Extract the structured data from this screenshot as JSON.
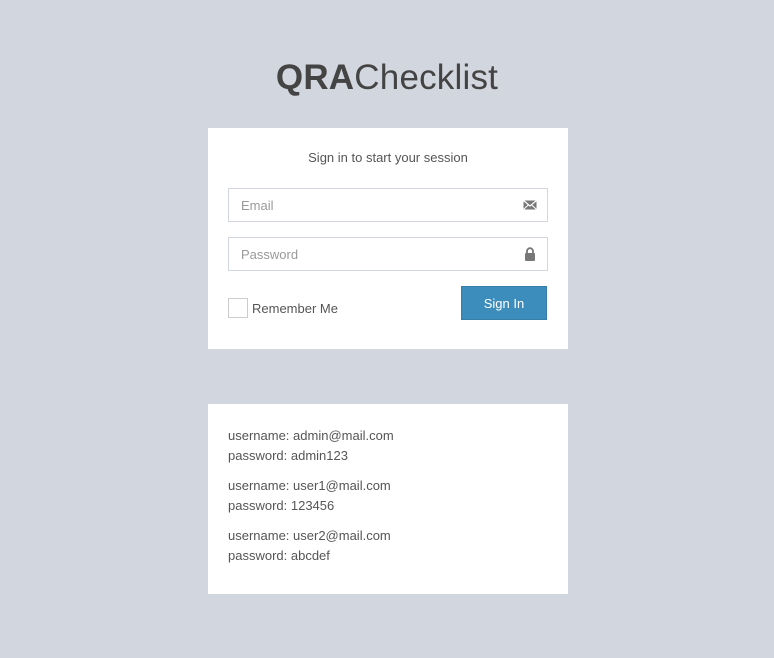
{
  "logo": {
    "bold": "QRA",
    "light": "Checklist"
  },
  "login": {
    "message": "Sign in to start your session",
    "email_placeholder": "Email",
    "password_placeholder": "Password",
    "remember_label": "Remember Me",
    "signin_label": "Sign In"
  },
  "credentials": [
    {
      "username": "username: admin@mail.com",
      "password": "password: admin123"
    },
    {
      "username": "username: user1@mail.com",
      "password": "password: 123456"
    },
    {
      "username": "username: user2@mail.com",
      "password": "password: abcdef"
    }
  ],
  "colors": {
    "background": "#d2d6de",
    "primary": "#3c8dbc",
    "text": "#444444"
  },
  "icons": {
    "email": "envelope-icon",
    "password": "lock-icon"
  }
}
